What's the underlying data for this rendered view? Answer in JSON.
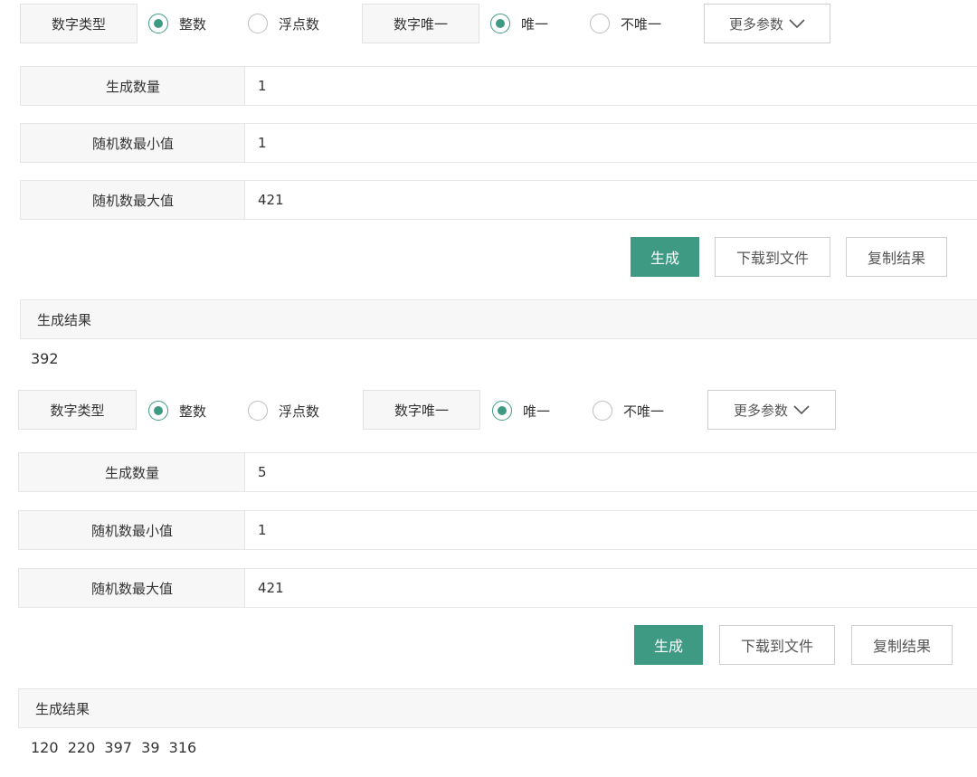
{
  "panel1": {
    "type_label": "数字类型",
    "type_options": [
      {
        "label": "整数",
        "selected": true
      },
      {
        "label": "浮点数",
        "selected": false
      }
    ],
    "unique_label": "数字唯一",
    "unique_options": [
      {
        "label": "唯一",
        "selected": true
      },
      {
        "label": "不唯一",
        "selected": false
      }
    ],
    "more_params": "更多参数",
    "fields": [
      {
        "label": "生成数量",
        "value": "1"
      },
      {
        "label": "随机数最小值",
        "value": "1"
      },
      {
        "label": "随机数最大值",
        "value": "421"
      }
    ],
    "buttons": {
      "generate": "生成",
      "download": "下载到文件",
      "copy": "复制结果"
    },
    "result_title": "生成结果",
    "result_value": "392"
  },
  "panel2": {
    "type_label": "数字类型",
    "type_options": [
      {
        "label": "整数",
        "selected": true
      },
      {
        "label": "浮点数",
        "selected": false
      }
    ],
    "unique_label": "数字唯一",
    "unique_options": [
      {
        "label": "唯一",
        "selected": true
      },
      {
        "label": "不唯一",
        "selected": false
      }
    ],
    "more_params": "更多参数",
    "fields": [
      {
        "label": "生成数量",
        "value": "5"
      },
      {
        "label": "随机数最小值",
        "value": "1"
      },
      {
        "label": "随机数最大值",
        "value": "421"
      }
    ],
    "buttons": {
      "generate": "生成",
      "download": "下载到文件",
      "copy": "复制结果"
    },
    "result_title": "生成结果",
    "result_value": "120  220  397  39  316"
  },
  "colors": {
    "accent": "#3f9a84",
    "label_bg": "#f7f7f7",
    "border": "#e6e6e6"
  },
  "icons": {
    "more_params": "chevron-down-icon"
  }
}
